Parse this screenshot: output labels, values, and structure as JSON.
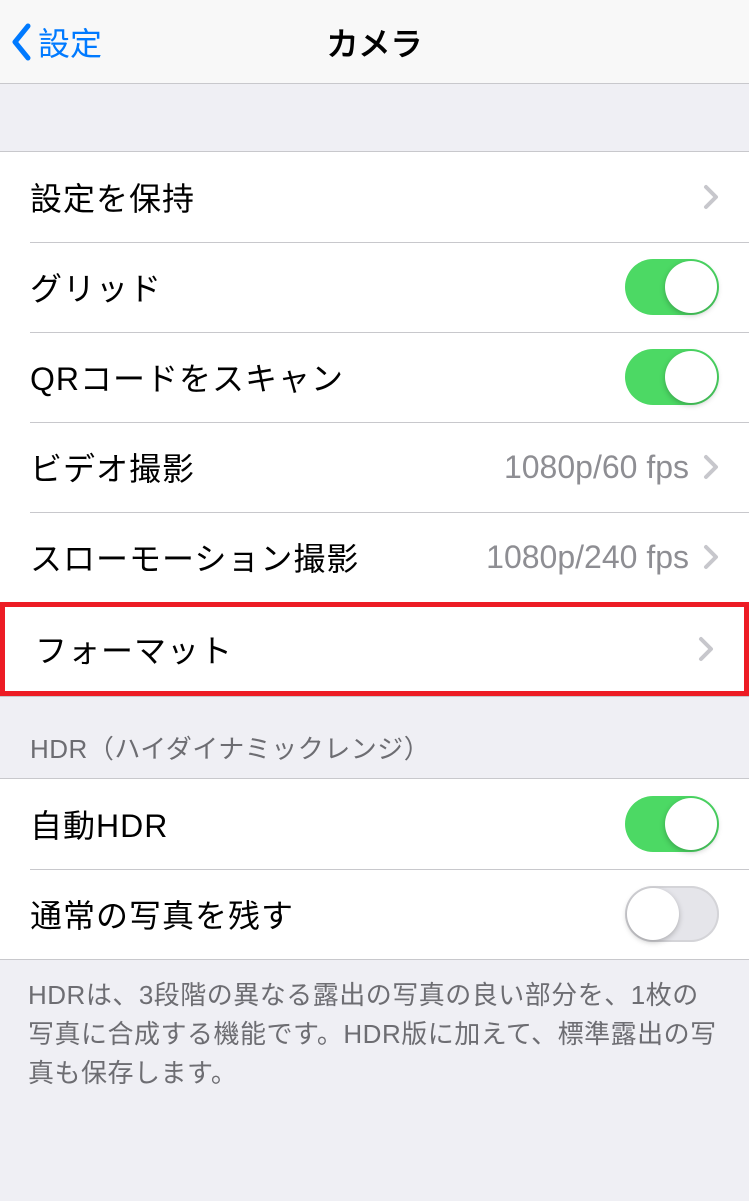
{
  "nav": {
    "back_label": "設定",
    "title": "カメラ"
  },
  "group1": {
    "preserve_settings": "設定を保持",
    "grid": "グリッド",
    "qr_scan": "QRコードをスキャン",
    "video_recording": "ビデオ撮影",
    "video_value": "1080p/60 fps",
    "slomo_recording": "スローモーション撮影",
    "slomo_value": "1080p/240 fps",
    "format": "フォーマット"
  },
  "hdr": {
    "header": "HDR（ハイダイナミックレンジ）",
    "auto_hdr": "自動HDR",
    "keep_normal": "通常の写真を残す",
    "footer": "HDRは、3段階の異なる露出の写真の良い部分を、1枚の写真に合成する機能です。HDR版に加えて、標準露出の写真も保存します。"
  }
}
